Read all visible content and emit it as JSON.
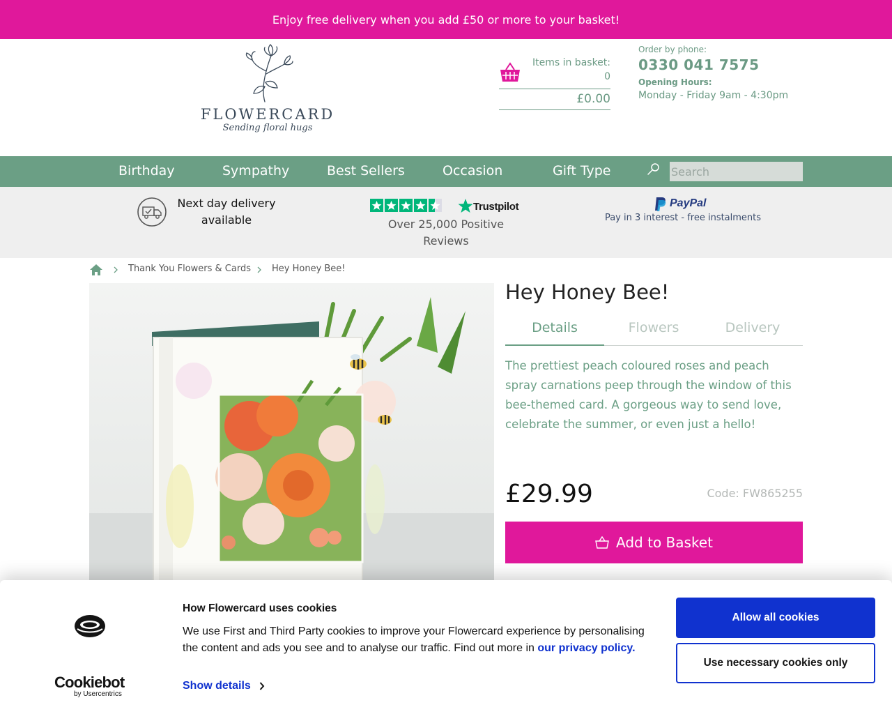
{
  "promo": {
    "text": "Enjoy free delivery when you add £50 or more to your basket!"
  },
  "logo": {
    "name": "FLOWERCARD",
    "tagline": "Sending floral hugs"
  },
  "basket": {
    "label": "Items in basket:",
    "count": "0",
    "total": "£0.00"
  },
  "contact": {
    "phone_label": "Order by phone:",
    "phone_number": "0330 041 7575",
    "hours_label": "Opening Hours:",
    "hours_value": "Monday - Friday 9am - 4:30pm"
  },
  "nav": {
    "items": [
      {
        "label": "Birthday"
      },
      {
        "label": "Sympathy"
      },
      {
        "label": "Best Sellers"
      },
      {
        "label": "Occasion"
      },
      {
        "label": "Gift Type"
      }
    ],
    "search_placeholder": "Search"
  },
  "usp": {
    "delivery_line1": "Next day delivery",
    "delivery_line2": "available",
    "trustpilot_brand": "Trustpilot",
    "trustpilot_line1": "Over 25,000 Positive",
    "trustpilot_line2": "Reviews",
    "paypal_brand": "PayPal",
    "paypal_text": "Pay in 3 interest - free instalments"
  },
  "breadcrumb": {
    "items": [
      {
        "label": "Thank You Flowers & Cards"
      },
      {
        "label": "Hey Honey Bee!"
      }
    ]
  },
  "product": {
    "title": "Hey Honey Bee!",
    "tabs": [
      {
        "label": "Details",
        "active": true
      },
      {
        "label": "Flowers",
        "active": false
      },
      {
        "label": "Delivery",
        "active": false
      }
    ],
    "description": "The prettiest peach coloured roses and peach spray carnations peep through the window of this bee-themed card. A gorgeous way to send love, celebrate the summer, or even just a hello!",
    "price": "£29.99",
    "code": "Code: FW865255",
    "add_to_basket": "Add to Basket"
  },
  "cookie": {
    "title": "How Flowercard uses cookies",
    "text": "We use First and Third Party cookies to improve your Flowercard experience by personalising the content and ads you see and to analyse our traffic. Find out more in ",
    "link": "our privacy policy.",
    "show_details": "Show details",
    "allow_all": "Allow all cookies",
    "necessary_only": "Use necessary cookies only",
    "brand_name": "Cookiebot",
    "brand_sub": "by Usercentrics"
  },
  "colors": {
    "brand_pink": "#e0189b",
    "brand_green": "#6b9f85",
    "cookie_blue": "#1032cf"
  }
}
